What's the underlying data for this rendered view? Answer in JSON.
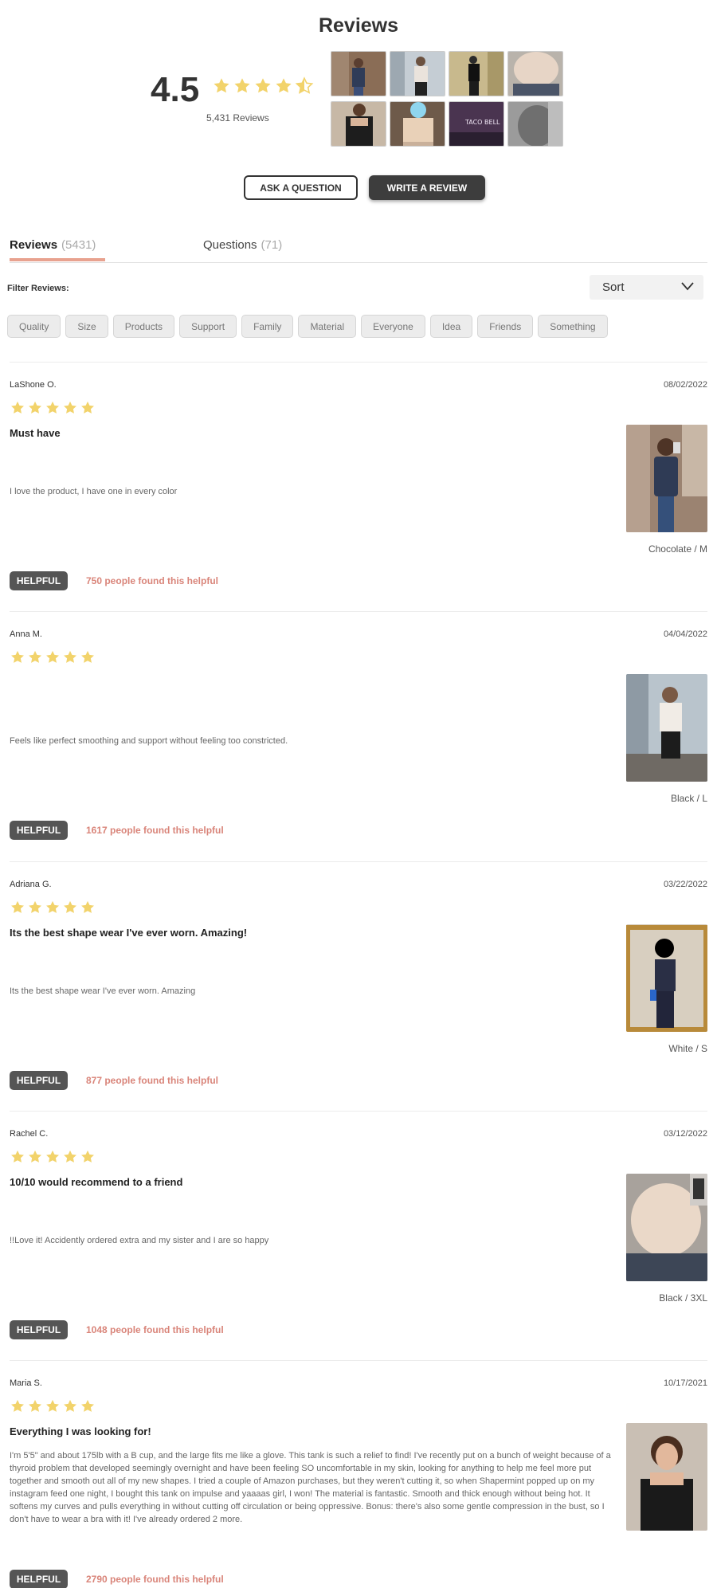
{
  "header": {
    "title": "Reviews",
    "average_rating": "4.5",
    "rating_value": 4.5,
    "total_reviews": "5,431 Reviews"
  },
  "buttons": {
    "ask": "ASK A QUESTION",
    "write": "WRITE A REVIEW"
  },
  "tabs": [
    {
      "label": "Reviews",
      "count": "(5431)"
    },
    {
      "label": "Questions",
      "count": "(71)"
    }
  ],
  "filters": {
    "label": "Filter Reviews:",
    "sort_label": "Sort",
    "chips": [
      "Quality",
      "Size",
      "Products",
      "Support",
      "Family",
      "Material",
      "Everyone",
      "Idea",
      "Friends",
      "Something"
    ]
  },
  "colors": {
    "star": "#f2d36b",
    "accent": "#e8a28f",
    "helpful_text": "#d98479",
    "button_dark": "#3d3d3d"
  },
  "reviews": [
    {
      "name": "LaShone O.",
      "date": "08/02/2022",
      "rating": 5,
      "title": "Must have",
      "body": "I love the product, I have one in every color",
      "variant": "Chocolate / M",
      "helpful_label": "HELPFUL",
      "helpful_count": "750 people found this helpful"
    },
    {
      "name": "Anna M.",
      "date": "04/04/2022",
      "rating": 5,
      "title": "",
      "body": "Feels like perfect smoothing and support without feeling too constricted.",
      "variant": "Black / L",
      "helpful_label": "HELPFUL",
      "helpful_count": "1617 people found this helpful"
    },
    {
      "name": "Adriana G.",
      "date": "03/22/2022",
      "rating": 5,
      "title": "Its the best shape wear I've ever worn. Amazing!",
      "body": "Its the best shape wear I've ever worn. Amazing",
      "variant": "White / S",
      "helpful_label": "HELPFUL",
      "helpful_count": "877 people found this helpful"
    },
    {
      "name": "Rachel C.",
      "date": "03/12/2022",
      "rating": 5,
      "title": "10/10 would recommend to a friend",
      "body": "!!Love it! Accidently ordered extra and my sister and I are so happy",
      "variant": "Black / 3XL",
      "helpful_label": "HELPFUL",
      "helpful_count": "1048 people found this helpful"
    },
    {
      "name": "Maria S.",
      "date": "10/17/2021",
      "rating": 5,
      "title": "Everything I was looking for!",
      "body": "I'm 5'5\" and about 175lb with a B cup, and the large fits me like a glove. This tank is such a relief to find! I've recently put on a bunch of weight because of a thyroid problem that developed seemingly overnight and have been feeling SO uncomfortable in my skin, looking for anything to help me feel more put together and smooth out all of my new shapes. I tried a couple of Amazon purchases, but they weren't cutting it, so when Shapermint popped up on my instagram feed one night, I bought this tank on impulse and yaaaas girl, I won! The material is fantastic. Smooth and thick enough without being hot. It softens my curves and pulls everything in without cutting off circulation or being oppressive. Bonus: there's also some gentle compression in the bust, so I don't have to wear a bra with it! I've already ordered 2 more.",
      "variant": "",
      "helpful_label": "HELPFUL",
      "helpful_count": "2790 people found this helpful"
    }
  ]
}
